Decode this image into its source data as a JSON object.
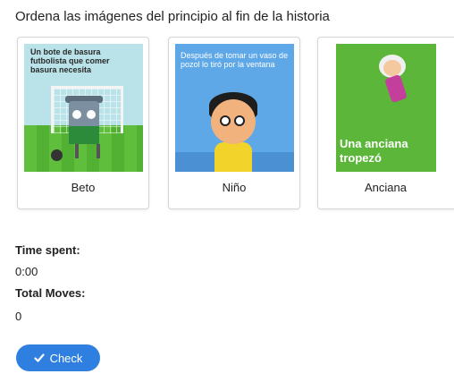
{
  "instruction": "Ordena las imágenes del principio al fin de la historia",
  "cards": [
    {
      "caption": "Beto",
      "image_text": "Un bote de basura futbolista que comer basura necesita"
    },
    {
      "caption": "Niño",
      "image_text": "Después de tomar un vaso de pozol lo tiró por la ventana"
    },
    {
      "caption": "Anciana",
      "image_text": "Una anciana tropezó"
    }
  ],
  "stats": {
    "time_label": "Time spent:",
    "time_value": "0:00",
    "moves_label": "Total Moves:",
    "moves_value": "0"
  },
  "check_button": {
    "label": "Check",
    "icon": "checkmark-icon",
    "color": "#2f7fe0"
  }
}
